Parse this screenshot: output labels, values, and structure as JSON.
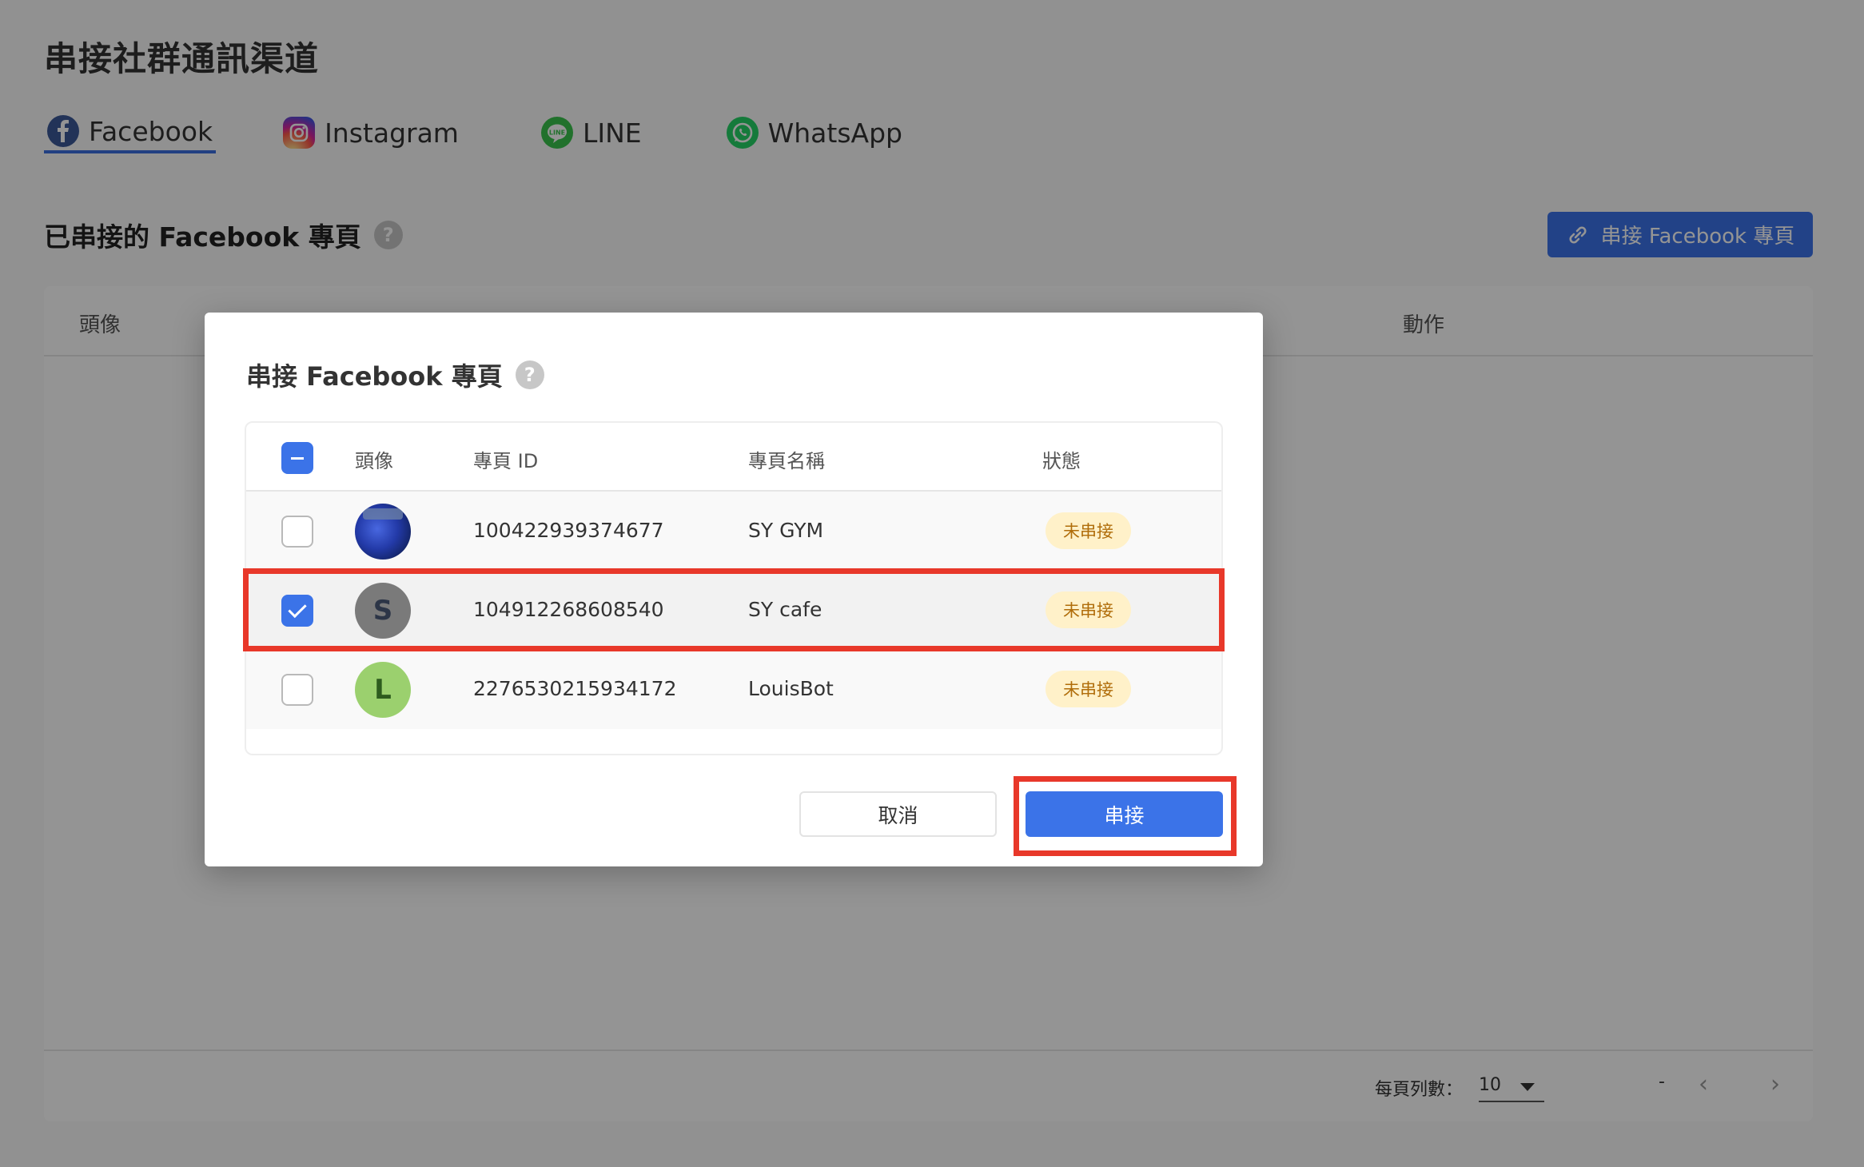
{
  "page": {
    "title": "串接社群通訊渠道",
    "tabs": [
      {
        "label": "Facebook",
        "icon": "facebook-icon",
        "active": true
      },
      {
        "label": "Instagram",
        "icon": "instagram-icon",
        "active": false
      },
      {
        "label": "LINE",
        "icon": "line-icon",
        "active": false
      },
      {
        "label": "WhatsApp",
        "icon": "whatsapp-icon",
        "active": false
      }
    ],
    "section_title": "已串接的 Facebook 專頁",
    "connect_button_label": "串接 Facebook 專頁",
    "table_headers": {
      "avatar": "頭像",
      "actions": "動作"
    },
    "footer": {
      "rows_per_page_label": "每頁列數：",
      "rows_per_page_value": "10",
      "range": "-"
    }
  },
  "dialog": {
    "title": "串接 Facebook 專頁",
    "columns": {
      "avatar": "頭像",
      "page_id": "專頁 ID",
      "page_name": "專頁名稱",
      "status": "狀態"
    },
    "rows": [
      {
        "page_id": "100422939374677",
        "page_name": "SY GYM",
        "status": "未串接",
        "avatar_letter": "",
        "checked": false
      },
      {
        "page_id": "104912268608540",
        "page_name": "SY cafe",
        "status": "未串接",
        "avatar_letter": "S",
        "checked": true
      },
      {
        "page_id": "2276530215934172",
        "page_name": "LouisBot",
        "status": "未串接",
        "avatar_letter": "L",
        "checked": false
      }
    ],
    "cancel_label": "取消",
    "connect_label": "串接"
  },
  "colors": {
    "accent": "#3b73e8",
    "highlight": "#e8382a",
    "badge_bg": "#fff1c9",
    "badge_text": "#b06d0a"
  }
}
